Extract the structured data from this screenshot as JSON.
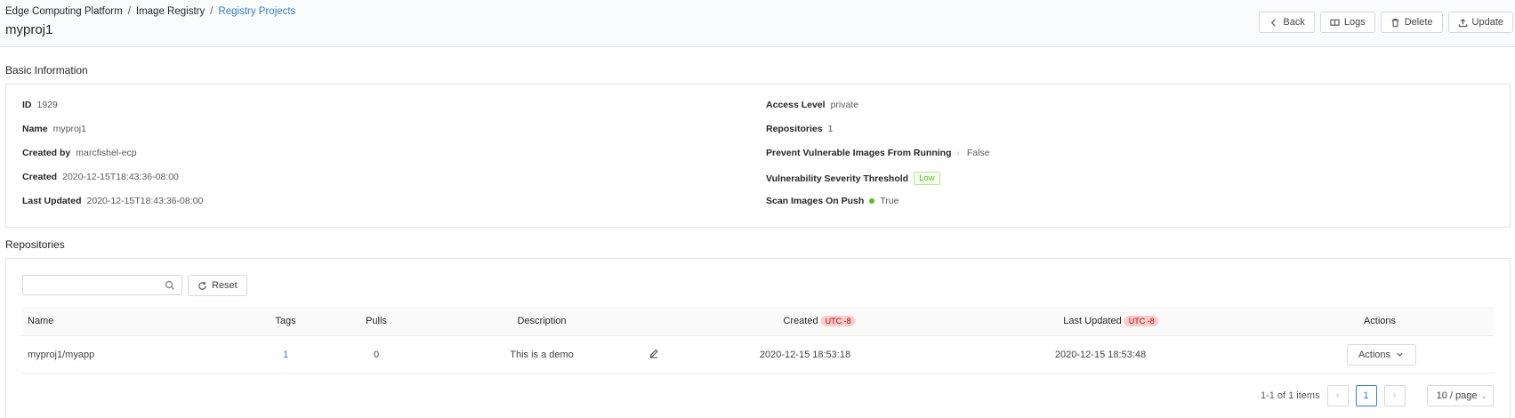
{
  "breadcrumb": [
    "Edge Computing Platform",
    "Image Registry",
    "Registry Projects"
  ],
  "page_title": "myproj1",
  "header_buttons": {
    "back": "Back",
    "logs": "Logs",
    "delete": "Delete",
    "update": "Update"
  },
  "basic_info": {
    "title": "Basic Information",
    "left": [
      {
        "label": "ID",
        "value": "1929"
      },
      {
        "label": "Name",
        "value": "myproj1"
      },
      {
        "label": "Created by",
        "value": "marcfishel-ecp"
      },
      {
        "label": "Created",
        "value": "2020-12-15T18:43:36-08:00"
      },
      {
        "label": "Last Updated",
        "value": "2020-12-15T18:43:36-08:00"
      }
    ],
    "right": {
      "access_level": {
        "label": "Access Level",
        "value": "private"
      },
      "repositories": {
        "label": "Repositories",
        "value": "1"
      },
      "prevent_vulnerable": {
        "label": "Prevent Vulnerable Images From Running",
        "value": "False"
      },
      "severity": {
        "label": "Vulnerability Severity Threshold",
        "value": "Low"
      },
      "scan_on_push": {
        "label": "Scan Images On Push",
        "value": "True"
      }
    }
  },
  "repositories": {
    "title": "Repositories",
    "search_placeholder": "",
    "reset_label": "Reset",
    "columns": {
      "name": "Name",
      "tags": "Tags",
      "pulls": "Pulls",
      "description": "Description",
      "created": "Created",
      "last_updated": "Last Updated",
      "actions": "Actions",
      "utc_badge": "UTC -8"
    },
    "rows": [
      {
        "name": "myproj1/myapp",
        "tags": "1",
        "pulls": "0",
        "description": "This is a demo",
        "created": "2020-12-15 18:53:18",
        "last_updated": "2020-12-15 18:53:48",
        "actions_label": "Actions"
      }
    ],
    "pagination": {
      "summary": "1-1 of 1 items",
      "current_page": "1",
      "page_size": "10 / page"
    }
  },
  "colors": {
    "accent": "#2f7fd6",
    "success": "#52c41a",
    "utc_badge_bg": "#ffccc7"
  }
}
